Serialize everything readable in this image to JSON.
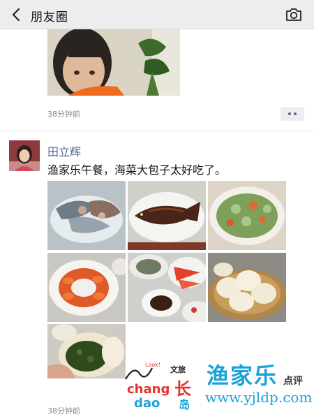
{
  "nav": {
    "title": "朋友圈",
    "back_icon": "chevron-left-icon",
    "camera_icon": "camera-icon"
  },
  "prev_post": {
    "time": "38分钟前",
    "more_icon": "more-dots-icon"
  },
  "post": {
    "author": "田立辉",
    "text": "渔家乐午餐，海菜大包子太好吃了。",
    "photos": [
      {
        "label": "seafood-platter"
      },
      {
        "label": "braised-fish"
      },
      {
        "label": "cucumber-salad"
      },
      {
        "label": "shrimp-plate"
      },
      {
        "label": "side-dishes"
      },
      {
        "label": "steamed-buns-basket"
      },
      {
        "label": "seaweed-bun-closeup"
      }
    ],
    "time": "38分钟前",
    "more_icon": "more-dots-icon"
  },
  "watermark": {
    "logo_small": "Look!",
    "logo_word1": "chang",
    "logo_word2": "dao",
    "logo_cn": "长岛",
    "logo_cn2": "文旅",
    "brand": "渔家乐",
    "brand_sub": "点评",
    "url": "www.yjldp.com"
  },
  "colors": {
    "link_blue": "#576b95",
    "nav_bg": "#ededed",
    "watermark_blue": "#1aa3d9"
  }
}
